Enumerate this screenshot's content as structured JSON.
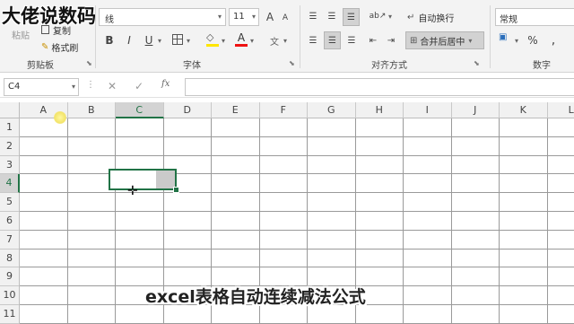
{
  "watermark": "大佬说数码",
  "clipboard": {
    "paste_label": "粘贴",
    "copy_label": "复制",
    "format_painter_label": "格式刷",
    "group_label": "剪贴板"
  },
  "font": {
    "font_name_partial": "线",
    "font_size": "11",
    "bold": "B",
    "italic": "I",
    "underline": "U",
    "grow": "A",
    "shrink": "A",
    "font_color_glyph": "A",
    "group_label": "字体"
  },
  "alignment": {
    "wrap_text_label": "自动换行",
    "merge_center_label": "合并后居中",
    "group_label": "对齐方式"
  },
  "number": {
    "format_value": "常规",
    "percent": "%",
    "comma": ",",
    "group_label": "数字"
  },
  "formula_bar": {
    "name_box": "C4",
    "fx": "fx",
    "formula": ""
  },
  "grid": {
    "columns": [
      "A",
      "B",
      "C",
      "D",
      "E",
      "F",
      "G",
      "H",
      "I",
      "J",
      "K",
      "L"
    ],
    "rows": [
      "1",
      "2",
      "3",
      "4",
      "5",
      "6",
      "7",
      "8",
      "9",
      "10",
      "11"
    ],
    "selected_cell": "C4"
  },
  "subtitle": "excel表格自动连续减法公式",
  "colors": {
    "ribbon_bg": "#f3f3f3",
    "selection_green": "#217346",
    "gridline": "#9a9a9a"
  }
}
